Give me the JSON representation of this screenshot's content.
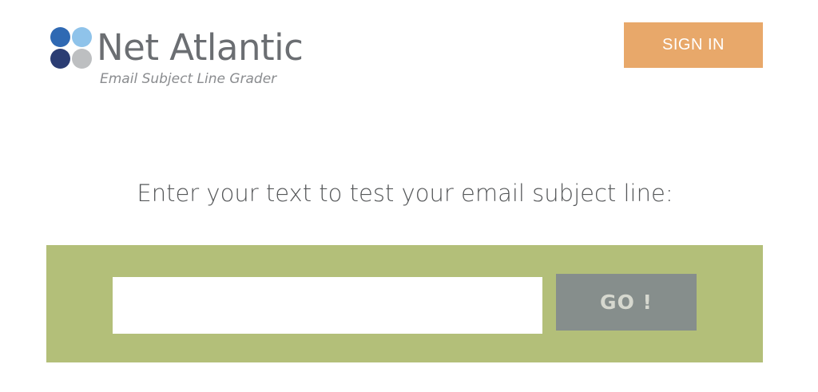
{
  "logo": {
    "name": "Net Atlantic",
    "tagline": "Email Subject Line Grader",
    "dot_colors": [
      "#2f69b3",
      "#8fc3ea",
      "#2b3d73",
      "#bdbfc1"
    ]
  },
  "header": {
    "sign_in_label": "SIGN IN"
  },
  "main": {
    "prompt": "Enter your text to test your email subject line:",
    "input": {
      "value": "",
      "placeholder": ""
    },
    "go_label": "GO !"
  },
  "colors": {
    "sign_in_bg": "#e8a86a",
    "band_bg": "#b3bf79",
    "go_bg": "#868e8c"
  }
}
